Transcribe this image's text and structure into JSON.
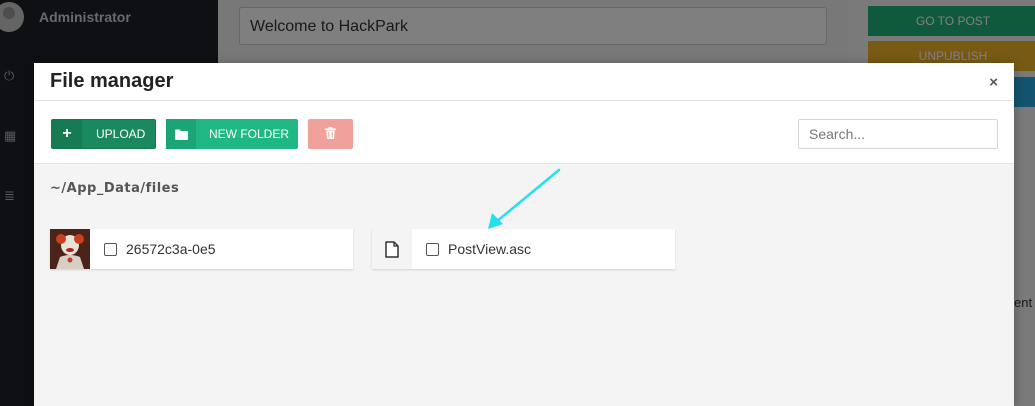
{
  "background": {
    "user": {
      "name": "Administrator"
    },
    "sidebar_icons": [
      "power-icon",
      "dashboard-icon",
      "list-icon"
    ],
    "post_title_value": "Welcome to HackPark",
    "actions": {
      "go_to_post": "GO TO POST",
      "unpublish": "UNPUBLISH"
    },
    "partial_text": "ent"
  },
  "modal": {
    "title": "File manager",
    "close": "×",
    "toolbar": {
      "upload_label": "UPLOAD",
      "new_folder_label": "NEW FOLDER",
      "search_placeholder": "Search..."
    },
    "path": "~/App_Data/files",
    "files": [
      {
        "name": "26572c3a-0e5",
        "type": "image"
      },
      {
        "name": "PostView.asc",
        "type": "file"
      }
    ]
  },
  "colors": {
    "upload": "#1a8a5e",
    "new_folder": "#1fb884",
    "delete": "#f0a19b",
    "annotation_arrow": "#22e0ee"
  }
}
